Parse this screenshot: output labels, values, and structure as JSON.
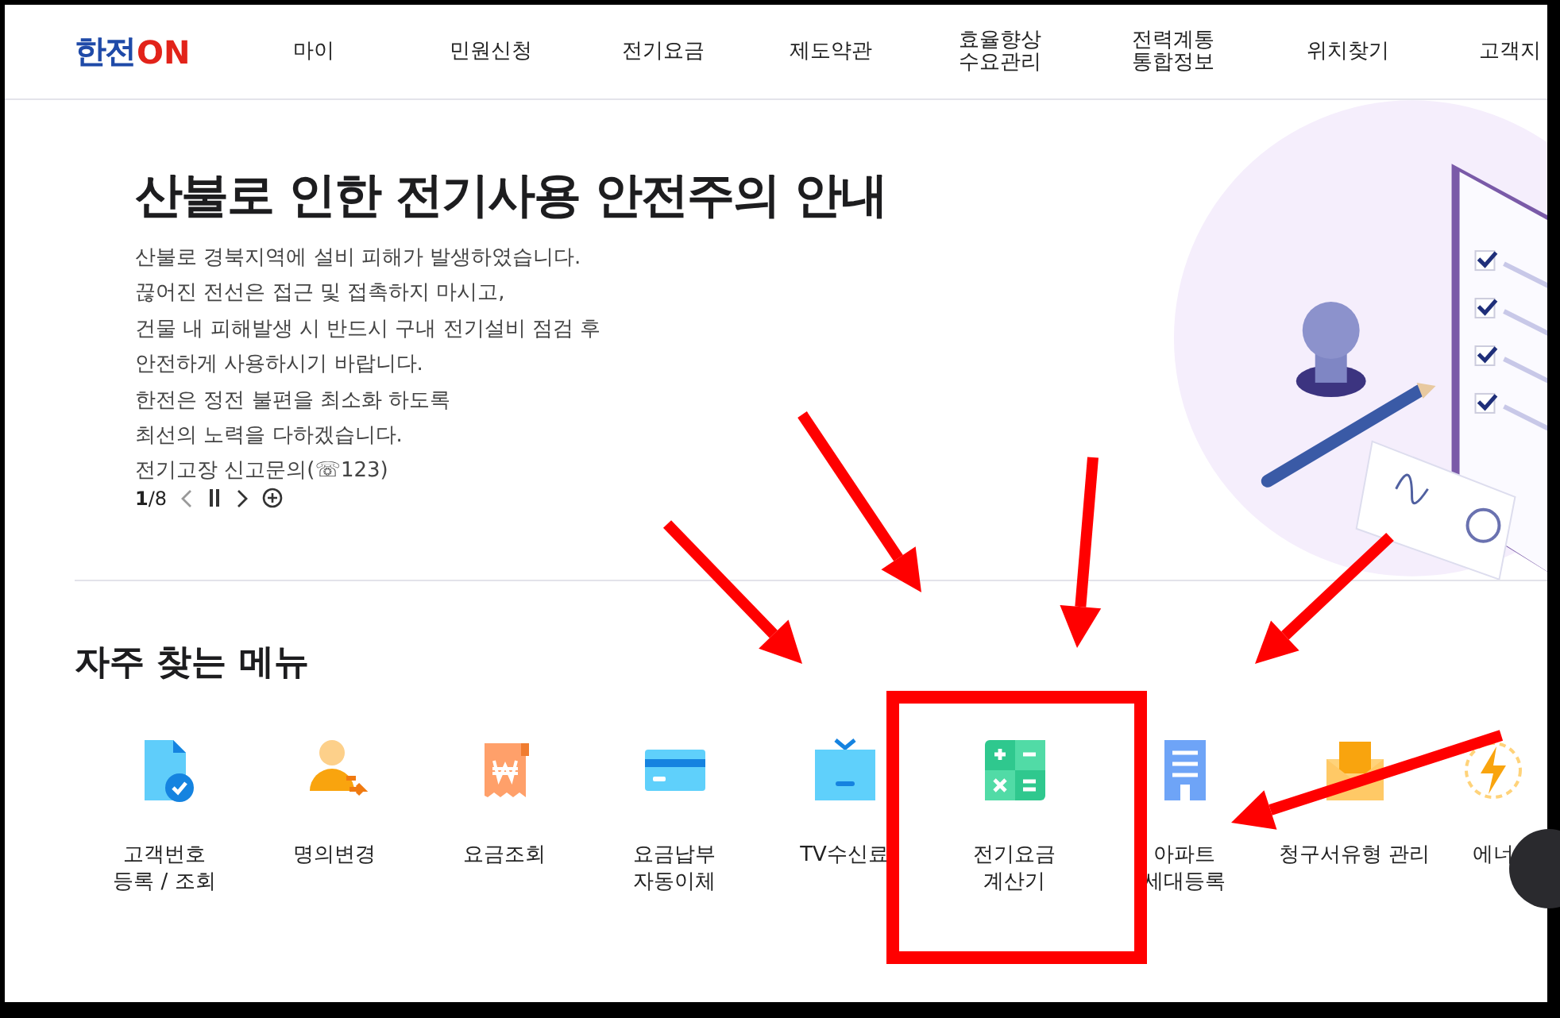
{
  "header": {
    "logo": {
      "text_1": "한전",
      "text_2": "ON"
    },
    "nav": [
      {
        "label": "마이"
      },
      {
        "label": "민원신청"
      },
      {
        "label": "전기요금"
      },
      {
        "label": "제도약관"
      },
      {
        "label": "효율향상\n수요관리"
      },
      {
        "label": "전력계통\n통합정보"
      },
      {
        "label": "위치찾기"
      },
      {
        "label": "고객지"
      }
    ]
  },
  "hero": {
    "title": "산불로 인한 전기사용 안전주의 안내",
    "lines": [
      "산불로 경북지역에 설비 피해가 발생하였습니다.",
      "끊어진 전선은 접근 및 접촉하지 마시고,",
      "건물 내 피해발생 시 반드시 구내 전기설비 점검 후",
      "안전하게 사용하시기 바랍니다.",
      "한전은 정전 불편을 최소화 하도록",
      "최선의 노력을 다하겠습니다.",
      "전기고장 신고문의(☏123)"
    ],
    "pager": {
      "current": "1",
      "total": "/8"
    }
  },
  "quick_menu": {
    "title": "자주 찾는 메뉴",
    "items": [
      {
        "label": "고객번호\n등록 / 조회"
      },
      {
        "label": "명의변경"
      },
      {
        "label": "요금조회"
      },
      {
        "label": "요금납부\n자동이체"
      },
      {
        "label": "TV수신료"
      },
      {
        "label": "전기요금\n계산기"
      },
      {
        "label": "아파트\n세대등록"
      },
      {
        "label": "청구서유형 관리"
      },
      {
        "label": "에너"
      }
    ]
  }
}
